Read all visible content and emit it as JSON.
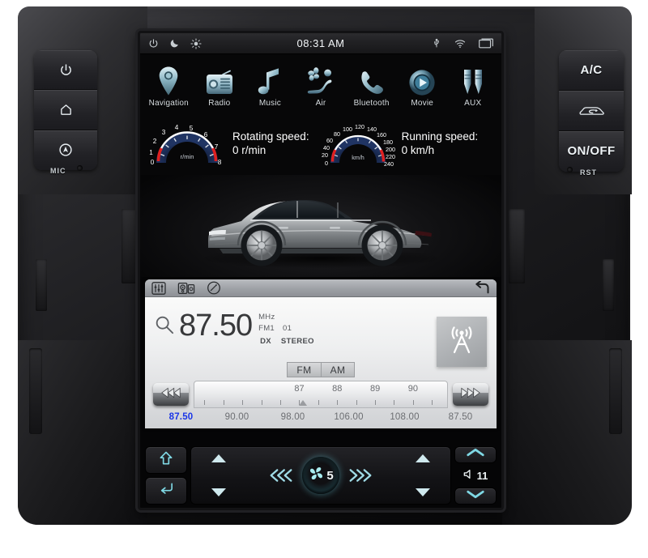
{
  "device": {
    "hardware_buttons_left": [
      {
        "name": "power",
        "icon": "power-icon"
      },
      {
        "name": "home",
        "icon": "home-icon"
      },
      {
        "name": "navigation",
        "icon": "navigation-icon"
      }
    ],
    "hardware_buttons_right": [
      {
        "name": "ac",
        "label": "A/C",
        "icon": null
      },
      {
        "name": "recirculation",
        "label": "",
        "icon": "car-recirculation-icon"
      },
      {
        "name": "onoff",
        "label": "ON/OFF",
        "icon": null
      }
    ],
    "mic_label": "MIC",
    "rst_label": "RST"
  },
  "status_bar": {
    "clock": "08:31 AM",
    "left_icons": [
      "power-icon",
      "night-mode-icon",
      "brightness-icon"
    ],
    "right_icons": [
      "usb-icon",
      "wifi-icon",
      "recent-apps-icon"
    ]
  },
  "apps": [
    {
      "label": "Navigation",
      "icon": "map-pin-icon"
    },
    {
      "label": "Radio",
      "icon": "radio-icon"
    },
    {
      "label": "Music",
      "icon": "music-note-icon"
    },
    {
      "label": "Air",
      "icon": "air-seat-icon"
    },
    {
      "label": "Bluetooth",
      "icon": "phone-icon"
    },
    {
      "label": "Movie",
      "icon": "play-circle-icon"
    },
    {
      "label": "AUX",
      "icon": "aux-plug-icon"
    }
  ],
  "gauges": {
    "tach": {
      "unit": "r/min",
      "ticks": [
        "0",
        "1",
        "2",
        "3",
        "4",
        "5",
        "6",
        "7",
        "8"
      ],
      "caption_title": "Rotating speed:",
      "caption_value": "0 r/min"
    },
    "speedo": {
      "unit": "km/h",
      "ticks": [
        "0",
        "20",
        "40",
        "60",
        "80",
        "100",
        "120",
        "140",
        "160",
        "180",
        "200",
        "220",
        "240"
      ],
      "caption_title": "Running speed:",
      "caption_value": "0 km/h"
    }
  },
  "hero": {
    "alt": "silver sedan side profile"
  },
  "radio": {
    "toolbar_icons": [
      "equalizer-icon",
      "audio-source-icon",
      "scan-icon"
    ],
    "back_icon": "back-arrow-icon",
    "search_icon": "search-icon",
    "frequency": "87.50",
    "unit": "MHz",
    "band_label": "FM1",
    "preset_number": "01",
    "sensitivity": "DX",
    "stereo": "STEREO",
    "tower_icon": "radio-tower-icon",
    "bands": [
      "FM",
      "AM"
    ],
    "seek_prev_icon": "seek-backward-icon",
    "seek_next_icon": "seek-forward-icon",
    "scale_numbers": [
      "87",
      "88",
      "89",
      "90"
    ],
    "presets": [
      {
        "value": "87.50",
        "active": true
      },
      {
        "value": "90.00",
        "active": false
      },
      {
        "value": "98.00",
        "active": false
      },
      {
        "value": "106.00",
        "active": false
      },
      {
        "value": "108.00",
        "active": false
      },
      {
        "value": "87.50",
        "active": false
      }
    ]
  },
  "climate": {
    "nav_home_icon": "home-up-arrow-icon",
    "nav_return_icon": "return-arrow-icon",
    "fan_speed": "5",
    "fan_icon": "fan-icon",
    "fan_decrease_icon": "chevron-left-triple-icon",
    "fan_increase_icon": "chevron-right-triple-icon",
    "temp_up_icon": "triangle-up-icon",
    "temp_down_icon": "triangle-down-icon",
    "volume": "11",
    "volume_icon": "speaker-icon",
    "volume_up_icon": "chevron-up-icon",
    "volume_down_icon": "chevron-down-icon"
  },
  "colors": {
    "accent_cyan": "#7fd8e4",
    "preset_active": "#1a36e8",
    "gauge_red": "#e02020",
    "panel_light": "#e8e9eb"
  }
}
